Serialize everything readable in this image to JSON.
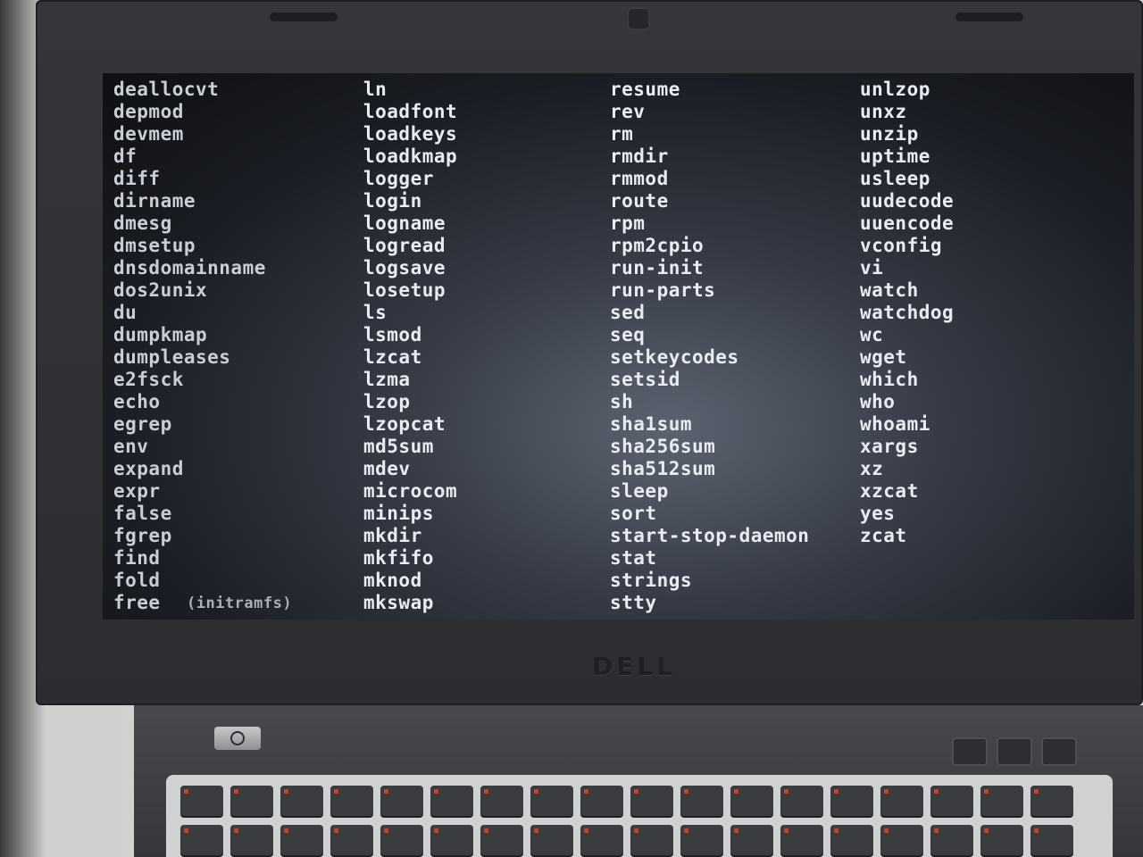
{
  "terminal": {
    "columns": [
      [
        "deallocvt",
        "depmod",
        "devmem",
        "df",
        "diff",
        "dirname",
        "dmesg",
        "dmsetup",
        "dnsdomainname",
        "dos2unix",
        "du",
        "dumpkmap",
        "dumpleases",
        "e2fsck",
        "echo",
        "egrep",
        "env",
        "expand",
        "expr",
        "false",
        "fgrep",
        "find",
        "fold",
        "free"
      ],
      [
        "ln",
        "loadfont",
        "loadkeys",
        "loadkmap",
        "logger",
        "login",
        "logname",
        "logread",
        "logsave",
        "losetup",
        "ls",
        "lsmod",
        "lzcat",
        "lzma",
        "lzop",
        "lzopcat",
        "md5sum",
        "mdev",
        "microcom",
        "minips",
        "mkdir",
        "mkfifo",
        "mknod",
        "mkswap"
      ],
      [
        "resume",
        "rev",
        "rm",
        "rmdir",
        "rmmod",
        "route",
        "rpm",
        "rpm2cpio",
        "run-init",
        "run-parts",
        "sed",
        "seq",
        "setkeycodes",
        "setsid",
        "sh",
        "sha1sum",
        "sha256sum",
        "sha512sum",
        "sleep",
        "sort",
        "start-stop-daemon",
        "stat",
        "strings",
        "stty"
      ],
      [
        "unlzop",
        "unxz",
        "unzip",
        "uptime",
        "usleep",
        "uudecode",
        "uuencode",
        "vconfig",
        "vi",
        "watch",
        "watchdog",
        "wc",
        "wget",
        "which",
        "who",
        "whoami",
        "xargs",
        "xz",
        "xzcat",
        "yes",
        "zcat"
      ]
    ],
    "prompt": "(initramfs)"
  },
  "laptop": {
    "brand": "DELL",
    "power_icon": "power-icon"
  }
}
